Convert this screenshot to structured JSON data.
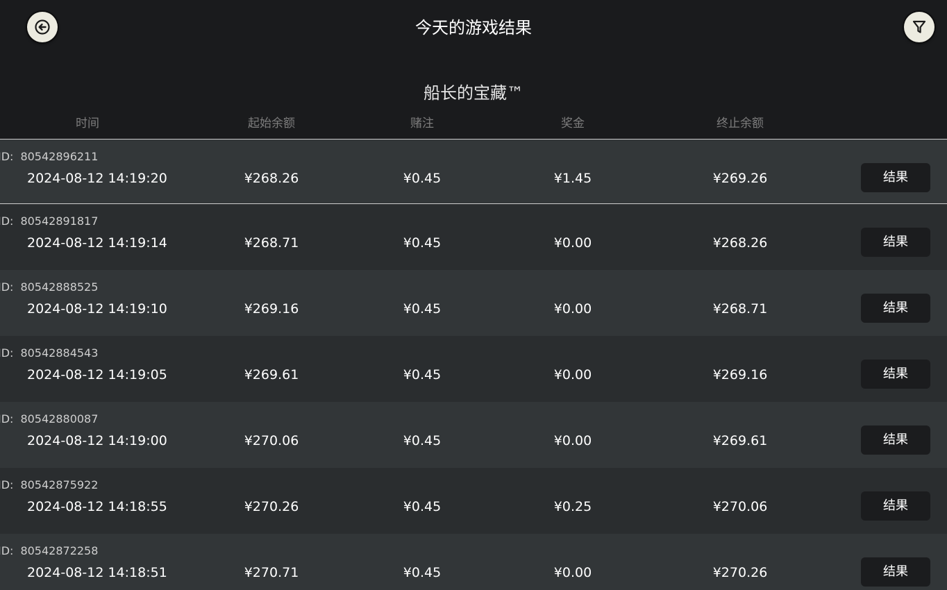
{
  "header": {
    "title": "今天的游戏结果",
    "back_icon": "back-arrow-icon",
    "filter_icon": "filter-funnel-icon"
  },
  "game": {
    "name": "船长的宝藏™"
  },
  "columns": {
    "time": "时间",
    "start_balance": "起始余额",
    "bet": "赌注",
    "bonus": "奖金",
    "end_balance": "终止余额"
  },
  "id_label": "ID:",
  "result_label": "结果",
  "rows": [
    {
      "id": "80542896211",
      "time": "2024-08-12 14:19:20",
      "start": "¥268.26",
      "bet": "¥0.45",
      "bonus": "¥1.45",
      "end": "¥269.26"
    },
    {
      "id": "80542891817",
      "time": "2024-08-12 14:19:14",
      "start": "¥268.71",
      "bet": "¥0.45",
      "bonus": "¥0.00",
      "end": "¥268.26"
    },
    {
      "id": "80542888525",
      "time": "2024-08-12 14:19:10",
      "start": "¥269.16",
      "bet": "¥0.45",
      "bonus": "¥0.00",
      "end": "¥268.71"
    },
    {
      "id": "80542884543",
      "time": "2024-08-12 14:19:05",
      "start": "¥269.61",
      "bet": "¥0.45",
      "bonus": "¥0.00",
      "end": "¥269.16"
    },
    {
      "id": "80542880087",
      "time": "2024-08-12 14:19:00",
      "start": "¥270.06",
      "bet": "¥0.45",
      "bonus": "¥0.00",
      "end": "¥269.61"
    },
    {
      "id": "80542875922",
      "time": "2024-08-12 14:18:55",
      "start": "¥270.26",
      "bet": "¥0.45",
      "bonus": "¥0.25",
      "end": "¥270.06"
    },
    {
      "id": "80542872258",
      "time": "2024-08-12 14:18:51",
      "start": "¥270.71",
      "bet": "¥0.45",
      "bonus": "¥0.00",
      "end": "¥270.26"
    }
  ],
  "colors": {
    "background": "#1a1b1d",
    "row": "#2a2d2f",
    "row_alt": "#323638",
    "button": "#1b1c1e",
    "icon_button": "#ecebe0"
  }
}
